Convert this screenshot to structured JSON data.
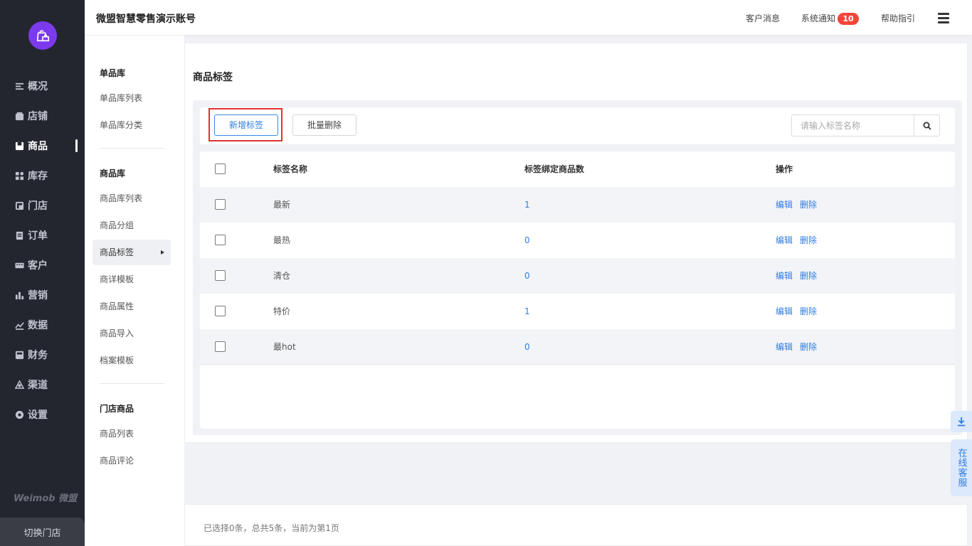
{
  "header": {
    "title": "微盟智慧零售演示账号",
    "customer_msg": "客户消息",
    "system_notice": "系统通知",
    "notice_count": "10",
    "help": "帮助指引"
  },
  "sidebar": {
    "items": [
      {
        "label": "概况",
        "icon": "list-icon"
      },
      {
        "label": "店铺",
        "icon": "store-icon"
      },
      {
        "label": "商品",
        "icon": "goods-icon",
        "active": true
      },
      {
        "label": "库存",
        "icon": "inventory-icon"
      },
      {
        "label": "门店",
        "icon": "shop-icon"
      },
      {
        "label": "订单",
        "icon": "order-icon"
      },
      {
        "label": "客户",
        "icon": "customer-icon"
      },
      {
        "label": "营销",
        "icon": "marketing-icon"
      },
      {
        "label": "数据",
        "icon": "data-icon"
      },
      {
        "label": "财务",
        "icon": "finance-icon"
      },
      {
        "label": "渠道",
        "icon": "channel-icon"
      },
      {
        "label": "设置",
        "icon": "settings-icon"
      }
    ],
    "brand": "Weimob 微盟",
    "switch_store": "切换门店"
  },
  "subnav": {
    "groups": [
      {
        "title": "单品库",
        "items": [
          "单品库列表",
          "单品库分类"
        ]
      },
      {
        "title": "商品库",
        "items": [
          "商品库列表",
          "商品分组",
          "商品标签",
          "商详模板",
          "商品属性",
          "商品导入",
          "档案模板"
        ]
      },
      {
        "title": "门店商品",
        "items": [
          "商品列表",
          "商品评论"
        ]
      }
    ],
    "active": "商品标签"
  },
  "page": {
    "title": "商品标签",
    "add_button": "新增标签",
    "batch_delete_button": "批量删除",
    "search_placeholder": "请输入标签名称"
  },
  "table": {
    "columns": [
      "标签名称",
      "标签绑定商品数",
      "操作"
    ],
    "rows": [
      {
        "name": "最新",
        "count": "1"
      },
      {
        "name": "最热",
        "count": "0"
      },
      {
        "name": "清仓",
        "count": "0"
      },
      {
        "name": "特价",
        "count": "1"
      },
      {
        "name": "最hot",
        "count": "0"
      }
    ],
    "edit_label": "编辑",
    "delete_label": "删除"
  },
  "footer": {
    "status": "已选择0条，总共5条，当前为第1页"
  },
  "float": {
    "online_service": "在线客服"
  },
  "colors": {
    "sidebar_bg": "#24262f",
    "accent": "#2f7de1",
    "badge": "#f5453b",
    "highlight": "#e52f2f"
  }
}
